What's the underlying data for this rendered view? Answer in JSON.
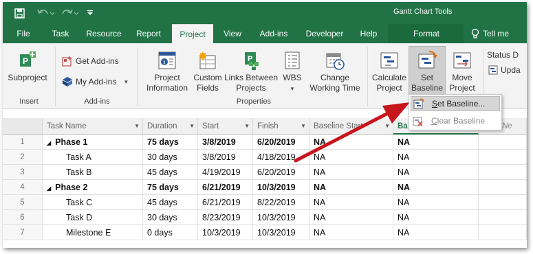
{
  "title_bar": {
    "context_title": "Gantt Chart Tools"
  },
  "tabs": [
    {
      "label": "File"
    },
    {
      "label": "Task"
    },
    {
      "label": "Resource"
    },
    {
      "label": "Report"
    },
    {
      "label": "Project"
    },
    {
      "label": "View"
    },
    {
      "label": "Add-ins"
    },
    {
      "label": "Developer"
    },
    {
      "label": "Help"
    },
    {
      "label": "Format"
    },
    {
      "label": "Tell me"
    }
  ],
  "active_tab": "Project",
  "ribbon": {
    "subproject": "Subproject",
    "insert_group": "Insert",
    "get_addins": "Get Add-ins",
    "my_addins": "My Add-ins",
    "addins_group": "Add-ins",
    "project_information_1": "Project",
    "project_information_2": "Information",
    "custom_fields_1": "Custom",
    "custom_fields_2": "Fields",
    "links_between_1": "Links Between",
    "links_between_2": "Projects",
    "wbs": "WBS",
    "change_working_time_1": "Change",
    "change_working_time_2": "Working Time",
    "properties_group": "Properties",
    "calculate_project_1": "Calculate",
    "calculate_project_2": "Project",
    "set_baseline_1": "Set",
    "set_baseline_2": "Baseline",
    "move_project_1": "Move",
    "move_project_2": "Project",
    "status_date": "Status D",
    "update": "Upda"
  },
  "menu": {
    "set_baseline": "Set Baseline...",
    "clear_baseline": "Clear Baseline"
  },
  "columns": [
    "Task Name",
    "Duration",
    "Start",
    "Finish",
    "Baseline Start",
    "Ba",
    "Ne"
  ],
  "rows": [
    {
      "id": "1",
      "name": "Phase 1",
      "duration": "75 days",
      "start": "3/8/2019",
      "finish": "6/20/2019",
      "bstart": "NA",
      "bfinish": "NA",
      "summary": true
    },
    {
      "id": "2",
      "name": "Task A",
      "duration": "30 days",
      "start": "3/8/2019",
      "finish": "4/18/2019",
      "bstart": "NA",
      "bfinish": "NA",
      "summary": false
    },
    {
      "id": "3",
      "name": "Task B",
      "duration": "45 days",
      "start": "4/19/2019",
      "finish": "6/20/2019",
      "bstart": "NA",
      "bfinish": "NA",
      "summary": false
    },
    {
      "id": "4",
      "name": "Phase 2",
      "duration": "75 days",
      "start": "6/21/2019",
      "finish": "10/3/2019",
      "bstart": "NA",
      "bfinish": "NA",
      "summary": true
    },
    {
      "id": "5",
      "name": "Task C",
      "duration": "45 days",
      "start": "6/21/2019",
      "finish": "8/22/2019",
      "bstart": "NA",
      "bfinish": "NA",
      "summary": false
    },
    {
      "id": "6",
      "name": "Task D",
      "duration": "30 days",
      "start": "8/23/2019",
      "finish": "10/3/2019",
      "bstart": "NA",
      "bfinish": "NA",
      "summary": false
    },
    {
      "id": "7",
      "name": "Milestone E",
      "duration": "0 days",
      "start": "10/3/2019",
      "finish": "10/3/2019",
      "bstart": "NA",
      "bfinish": "NA",
      "summary": false
    }
  ],
  "colors": {
    "brand_green": "#217346",
    "arrow_red": "#c8161d"
  }
}
